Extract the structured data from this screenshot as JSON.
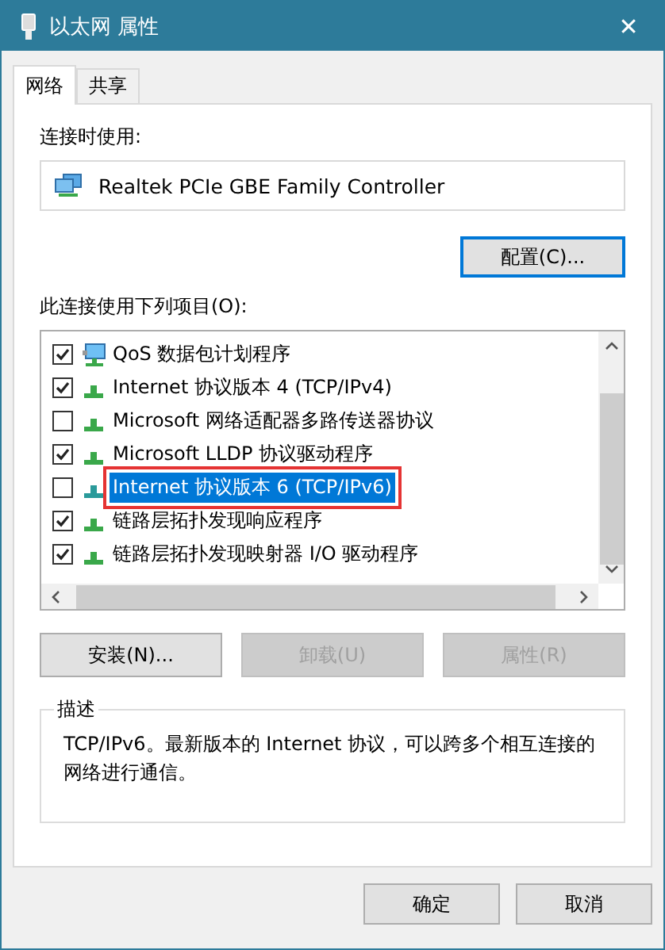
{
  "window": {
    "title": "以太网 属性",
    "close": "✕"
  },
  "tabs": [
    {
      "label": "网络",
      "selected": true
    },
    {
      "label": "共享",
      "selected": false
    }
  ],
  "connect_using": {
    "label": "连接时使用:",
    "adapter": "Realtek PCIe GBE Family Controller",
    "configure_button": "配置(C)..."
  },
  "items_label": "此连接使用下列项目(O):",
  "items": [
    {
      "kind": "scheduler",
      "label": "QoS 数据包计划程序",
      "checked": true,
      "selected": false,
      "annotated": false
    },
    {
      "kind": "protocol",
      "label": "Internet 协议版本 4 (TCP/IPv4)",
      "checked": true,
      "selected": false,
      "annotated": false
    },
    {
      "kind": "protocol",
      "label": "Microsoft 网络适配器多路传送器协议",
      "checked": false,
      "selected": false,
      "annotated": false
    },
    {
      "kind": "protocol",
      "label": "Microsoft LLDP 协议驱动程序",
      "checked": true,
      "selected": false,
      "annotated": false
    },
    {
      "kind": "protocol",
      "label": "Internet 协议版本 6 (TCP/IPv6)",
      "checked": false,
      "selected": true,
      "annotated": true
    },
    {
      "kind": "protocol",
      "label": "链路层拓扑发现响应程序",
      "checked": true,
      "selected": false,
      "annotated": false
    },
    {
      "kind": "protocol",
      "label": "链路层拓扑发现映射器 I/O 驱动程序",
      "checked": true,
      "selected": false,
      "annotated": false
    }
  ],
  "item_buttons": [
    {
      "label": "安装(N)...",
      "disabled": false
    },
    {
      "label": "卸载(U)",
      "disabled": true
    },
    {
      "label": "属性(R)",
      "disabled": true
    }
  ],
  "description": {
    "title": "描述",
    "text": "TCP/IPv6。最新版本的 Internet 协议，可以跨多个相互连接的网络进行通信。"
  },
  "dialog_buttons": [
    "确定",
    "取消"
  ]
}
